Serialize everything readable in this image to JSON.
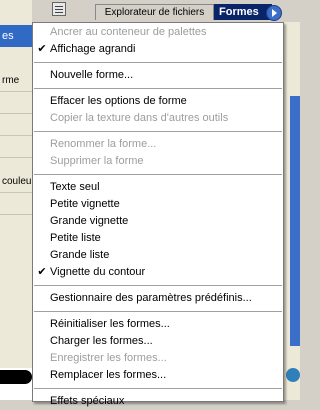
{
  "background": {
    "left_items": [
      "es",
      "rme",
      "couleur"
    ],
    "tabs": {
      "inactive": "Explorateur de fichiers",
      "active": "Formes"
    }
  },
  "menu": {
    "items": [
      {
        "label": "Ancrer au conteneur de palettes",
        "disabled": true
      },
      {
        "label": "Affichage agrandi",
        "checked": true,
        "check_mark": "✔"
      },
      {
        "sep": true
      },
      {
        "label": "Nouvelle forme..."
      },
      {
        "sep": true
      },
      {
        "label": "Effacer les options de forme"
      },
      {
        "label": "Copier la texture dans d'autres outils",
        "disabled": true
      },
      {
        "sep": true
      },
      {
        "label": "Renommer la forme...",
        "disabled": true
      },
      {
        "label": "Supprimer la forme",
        "disabled": true
      },
      {
        "sep": true
      },
      {
        "label": "Texte seul"
      },
      {
        "label": "Petite vignette"
      },
      {
        "label": "Grande vignette"
      },
      {
        "label": "Petite liste"
      },
      {
        "label": "Grande liste"
      },
      {
        "label": "Vignette du contour",
        "checked": true,
        "check_mark": "✔"
      },
      {
        "sep": true
      },
      {
        "label": "Gestionnaire des paramètres prédéfinis..."
      },
      {
        "sep": true
      },
      {
        "label": "Réinitialiser les formes..."
      },
      {
        "label": "Charger les formes..."
      },
      {
        "label": "Enregistrer les formes...",
        "disabled": true
      },
      {
        "label": "Remplacer les formes..."
      },
      {
        "sep": true
      },
      {
        "label": "Effets spéciaux"
      }
    ]
  }
}
